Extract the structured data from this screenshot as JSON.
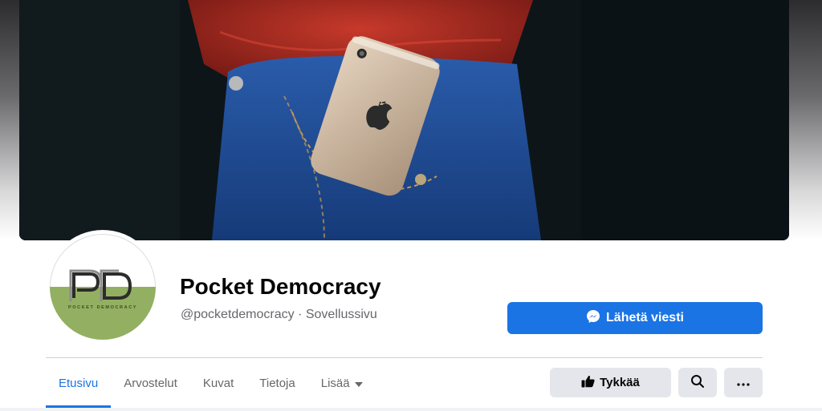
{
  "page": {
    "title": "Pocket Democracy",
    "username": "@pocketdemocracy",
    "separator": " · ",
    "category": "Sovellussivu"
  },
  "avatar": {
    "logo_text": "PD",
    "subtext": "POCKET DEMOCRACY"
  },
  "actions": {
    "send_message": "Lähetä viesti",
    "like": "Tykkää",
    "search_icon": "search-icon",
    "more_icon": "more-icon"
  },
  "tabs": [
    {
      "label": "Etusivu",
      "active": true
    },
    {
      "label": "Arvostelut"
    },
    {
      "label": "Kuvat"
    },
    {
      "label": "Tietoja"
    },
    {
      "label": "Lisää"
    }
  ],
  "colors": {
    "accent": "#1b74e4",
    "button_gray": "#e4e6eb",
    "logo_green": "#93b062"
  }
}
